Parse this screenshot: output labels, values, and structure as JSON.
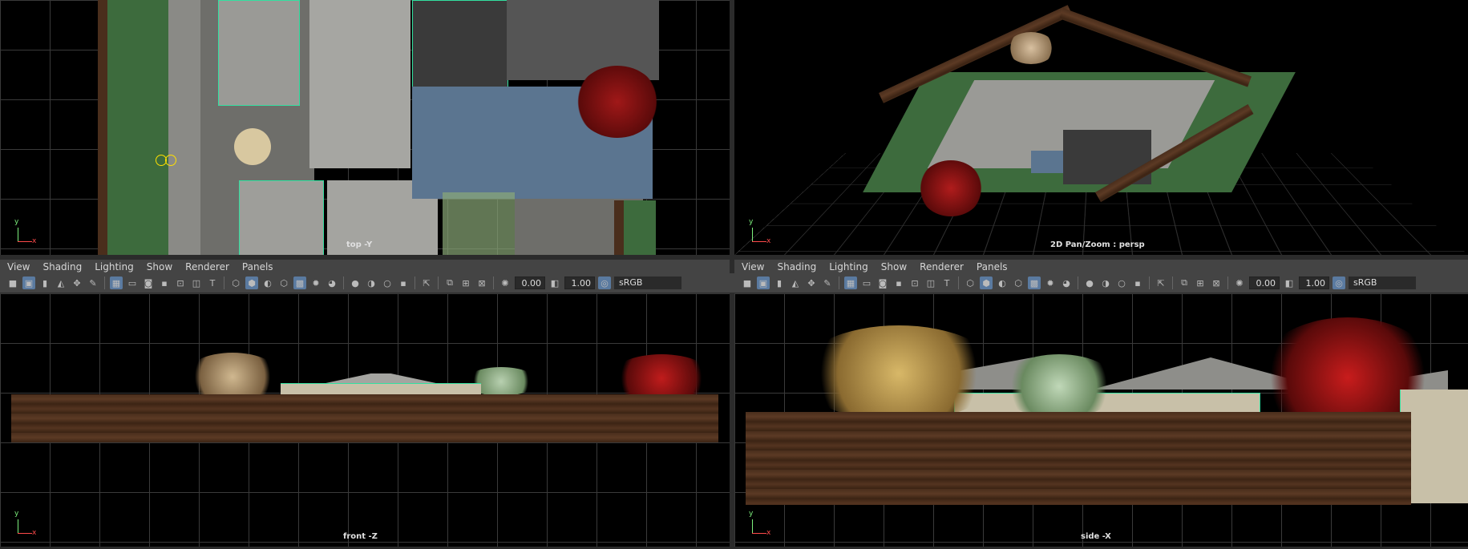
{
  "viewports": {
    "top": {
      "label": "top -Y"
    },
    "persp": {
      "label": "2D Pan/Zoom : persp"
    },
    "front": {
      "label": "front -Z"
    },
    "side": {
      "label": "side -X"
    }
  },
  "axis": {
    "y": "y",
    "x": "x",
    "z": "z"
  },
  "panel_menu": {
    "view": "View",
    "shading": "Shading",
    "lighting": "Lighting",
    "show": "Show",
    "renderer": "Renderer",
    "panels": "Panels"
  },
  "toolbar": {
    "exposure": "0.00",
    "gamma_value": "1.00",
    "color_space": "sRGB gamma"
  },
  "colors": {
    "viewport_bg": "#000000",
    "panel_bg": "#444444",
    "grid": "#3a3a3a",
    "selection": "#33e0a0",
    "wood": "#5c3a24",
    "grass": "#3d6b3d"
  }
}
